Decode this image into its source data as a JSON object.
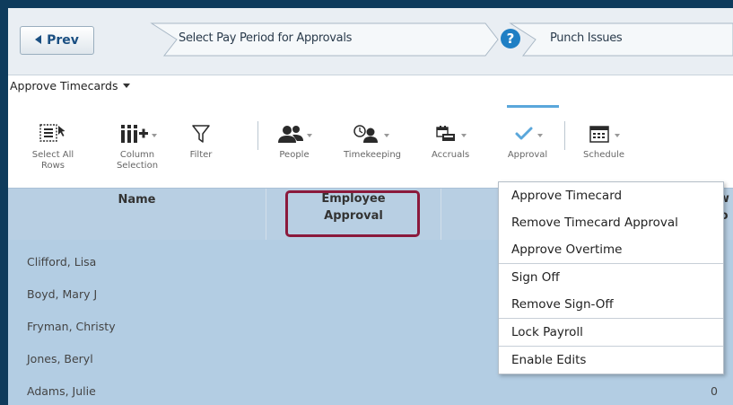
{
  "wizard": {
    "prev_label": "Prev",
    "steps": [
      "Select Pay Period for Approvals",
      "Punch Issues"
    ],
    "help_glyph": "?"
  },
  "action_menu": {
    "label": "Approve Timecards"
  },
  "toolbar": {
    "buttons": [
      {
        "label_lines": [
          "Select All",
          "Rows"
        ],
        "icon": "select-rows-icon"
      },
      {
        "label_lines": [
          "Column",
          "Selection"
        ],
        "icon": "column-add-icon"
      },
      {
        "label_lines": [
          "Filter"
        ],
        "icon": "filter-icon"
      },
      {
        "label_lines": [
          "People"
        ],
        "icon": "people-icon"
      },
      {
        "label_lines": [
          "Timekeeping"
        ],
        "icon": "timekeeping-icon"
      },
      {
        "label_lines": [
          "Accruals"
        ],
        "icon": "accruals-icon"
      },
      {
        "label_lines": [
          "Approval"
        ],
        "icon": "check-icon"
      },
      {
        "label_lines": [
          "Schedule"
        ],
        "icon": "calendar-icon"
      }
    ],
    "active_tab_color": "#5aa7db"
  },
  "grid": {
    "columns": [
      {
        "label_lines": [
          "Name"
        ]
      },
      {
        "label_lines": [
          "Employee",
          "Approval"
        ]
      },
      {
        "label_lines": [
          "ew",
          "tio"
        ]
      }
    ],
    "rows": [
      {
        "name": "Clifford, Lisa",
        "value": ""
      },
      {
        "name": "Boyd, Mary J",
        "value": ""
      },
      {
        "name": "Fryman, Christy",
        "value": ""
      },
      {
        "name": "Jones, Beryl",
        "value": ""
      },
      {
        "name": "Adams, Julie",
        "value": "0"
      }
    ],
    "highlight_color": "#8b1a3c"
  },
  "approval_menu": {
    "items": [
      "Approve Timecard",
      "Remove Timecard Approval",
      "Approve Overtime",
      "Sign Off",
      "Remove Sign-Off",
      "Lock Payroll",
      "Enable Edits"
    ]
  }
}
